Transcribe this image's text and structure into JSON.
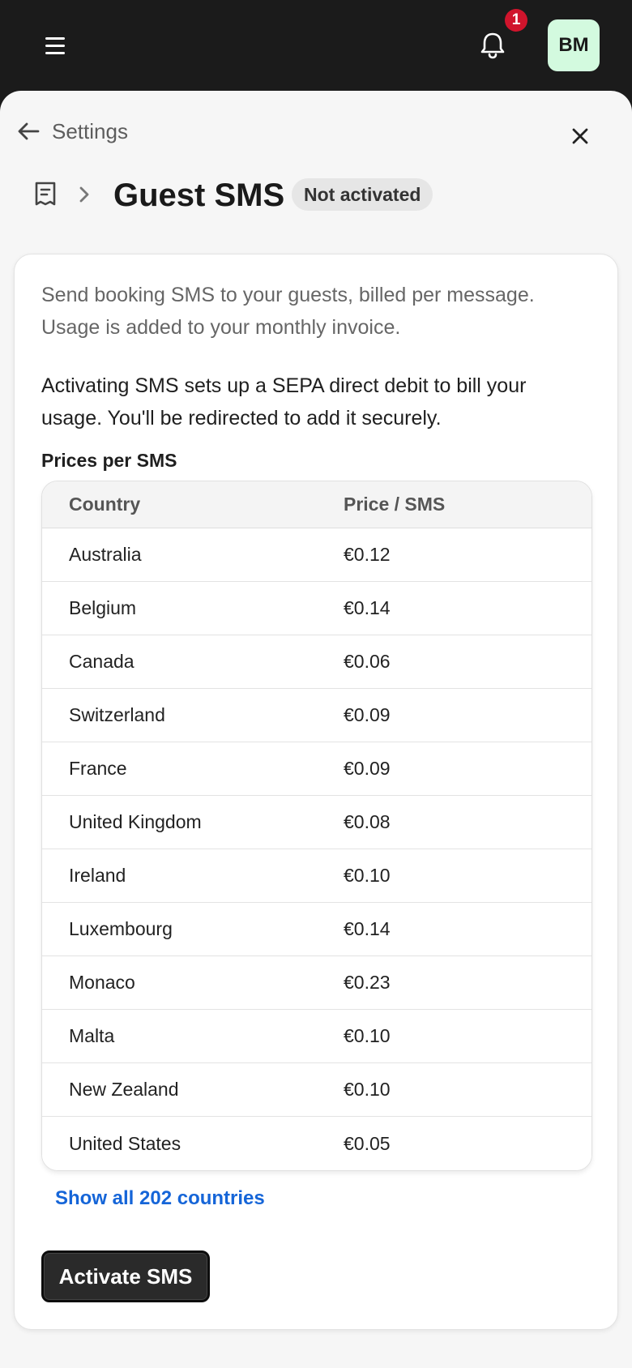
{
  "header": {
    "notification_count": "1",
    "avatar_initials": "BM"
  },
  "nav": {
    "back_label": "Settings"
  },
  "page": {
    "title": "Guest SMS",
    "status": "Not activated"
  },
  "card": {
    "description": "Send booking SMS to your guests, billed per message. Usage is added to your monthly invoice.",
    "notice": "Activating SMS sets up a SEPA direct debit to bill your usage. You'll be redirected to add it securely.",
    "prices_heading": "Prices per SMS",
    "table": {
      "columns": [
        "Country",
        "Price / SMS"
      ],
      "rows": [
        {
          "country": "Australia",
          "price": "€0.12"
        },
        {
          "country": "Belgium",
          "price": "€0.14"
        },
        {
          "country": "Canada",
          "price": "€0.06"
        },
        {
          "country": "Switzerland",
          "price": "€0.09"
        },
        {
          "country": "France",
          "price": "€0.09"
        },
        {
          "country": "United Kingdom",
          "price": "€0.08"
        },
        {
          "country": "Ireland",
          "price": "€0.10"
        },
        {
          "country": "Luxembourg",
          "price": "€0.14"
        },
        {
          "country": "Monaco",
          "price": "€0.23"
        },
        {
          "country": "Malta",
          "price": "€0.10"
        },
        {
          "country": "New Zealand",
          "price": "€0.10"
        },
        {
          "country": "United States",
          "price": "€0.05"
        }
      ]
    },
    "show_all_label": "Show all 202 countries",
    "activate_label": "Activate SMS"
  },
  "icons": {
    "menu": "menu-icon",
    "bell": "bell-icon",
    "back": "arrow-left-icon",
    "close": "close-icon",
    "breadcrumb": "receipt-icon",
    "chevron": "chevron-right-icon"
  },
  "colors": {
    "topbar": "#1b1b1b",
    "badge": "#d0142c",
    "avatar_bg": "#d3fadf",
    "link": "#1565d8",
    "primary_button": "#2a2a2a"
  }
}
